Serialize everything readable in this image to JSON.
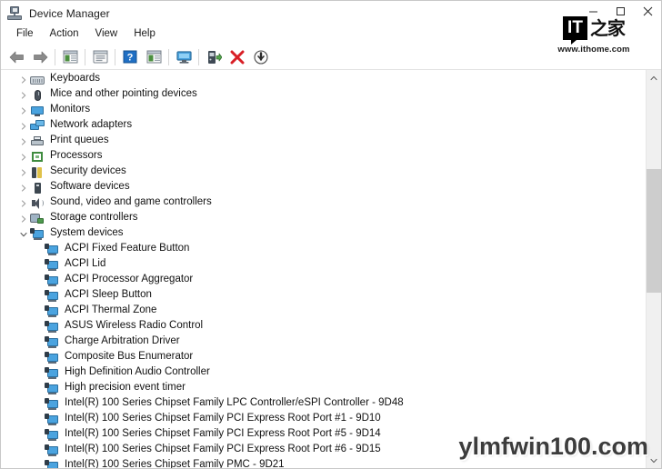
{
  "window": {
    "title": "Device Manager",
    "icon": "device-manager-icon",
    "controls": {
      "minimize": "–",
      "maximize": "□",
      "close": "✕"
    }
  },
  "menubar": {
    "items": [
      {
        "label": "File"
      },
      {
        "label": "Action"
      },
      {
        "label": "View"
      },
      {
        "label": "Help"
      }
    ]
  },
  "toolbar": {
    "buttons": [
      {
        "name": "back-arrow-icon",
        "tooltip": "Back"
      },
      {
        "name": "forward-arrow-icon",
        "tooltip": "Forward"
      },
      {
        "name": "properties-icon",
        "tooltip": "Properties"
      },
      {
        "name": "update-driver-window-icon",
        "tooltip": "Update driver"
      },
      {
        "name": "help-icon",
        "tooltip": "Help"
      },
      {
        "name": "show-hidden-devices-icon",
        "tooltip": "Show hidden devices"
      },
      {
        "name": "scan-hardware-changes-icon",
        "tooltip": "Scan for hardware changes"
      },
      {
        "name": "update-driver-green-icon",
        "tooltip": "Update driver software"
      },
      {
        "name": "uninstall-device-icon",
        "tooltip": "Uninstall device"
      },
      {
        "name": "download-driver-icon",
        "tooltip": "Download"
      }
    ]
  },
  "tree": {
    "nodes": [
      {
        "label": "Keyboards",
        "icon": "keyboard-icon",
        "level": 0,
        "expanded": false
      },
      {
        "label": "Mice and other pointing devices",
        "icon": "mouse-icon",
        "level": 0,
        "expanded": false
      },
      {
        "label": "Monitors",
        "icon": "monitor-icon",
        "level": 0,
        "expanded": false
      },
      {
        "label": "Network adapters",
        "icon": "network-icon",
        "level": 0,
        "expanded": false
      },
      {
        "label": "Print queues",
        "icon": "printer-icon",
        "level": 0,
        "expanded": false
      },
      {
        "label": "Processors",
        "icon": "processor-icon",
        "level": 0,
        "expanded": false
      },
      {
        "label": "Security devices",
        "icon": "security-icon",
        "level": 0,
        "expanded": false
      },
      {
        "label": "Software devices",
        "icon": "software-icon",
        "level": 0,
        "expanded": false
      },
      {
        "label": "Sound, video and game controllers",
        "icon": "sound-icon",
        "level": 0,
        "expanded": false
      },
      {
        "label": "Storage controllers",
        "icon": "storage-icon",
        "level": 0,
        "expanded": false
      },
      {
        "label": "System devices",
        "icon": "system-device-icon",
        "level": 0,
        "expanded": true
      },
      {
        "label": "ACPI Fixed Feature Button",
        "icon": "system-device-icon",
        "level": 1
      },
      {
        "label": "ACPI Lid",
        "icon": "system-device-icon",
        "level": 1
      },
      {
        "label": "ACPI Processor Aggregator",
        "icon": "system-device-icon",
        "level": 1
      },
      {
        "label": "ACPI Sleep Button",
        "icon": "system-device-icon",
        "level": 1
      },
      {
        "label": "ACPI Thermal Zone",
        "icon": "system-device-icon",
        "level": 1
      },
      {
        "label": "ASUS Wireless Radio Control",
        "icon": "system-device-icon",
        "level": 1
      },
      {
        "label": "Charge Arbitration Driver",
        "icon": "system-device-icon",
        "level": 1
      },
      {
        "label": "Composite Bus Enumerator",
        "icon": "system-device-icon",
        "level": 1
      },
      {
        "label": "High Definition Audio Controller",
        "icon": "system-device-icon",
        "level": 1
      },
      {
        "label": "High precision event timer",
        "icon": "system-device-icon",
        "level": 1
      },
      {
        "label": "Intel(R) 100 Series Chipset Family LPC Controller/eSPI Controller - 9D48",
        "icon": "system-device-icon",
        "level": 1
      },
      {
        "label": "Intel(R) 100 Series Chipset Family PCI Express Root Port #1 - 9D10",
        "icon": "system-device-icon",
        "level": 1
      },
      {
        "label": "Intel(R) 100 Series Chipset Family PCI Express Root Port #5 - 9D14",
        "icon": "system-device-icon",
        "level": 1
      },
      {
        "label": "Intel(R) 100 Series Chipset Family PCI Express Root Port #6 - 9D15",
        "icon": "system-device-icon",
        "level": 1
      },
      {
        "label": "Intel(R) 100 Series Chipset Family PMC - 9D21",
        "icon": "system-device-icon",
        "level": 1
      }
    ]
  },
  "scrollbar": {
    "up_arrow": "⌃",
    "down_arrow": "⌄"
  },
  "watermarks": {
    "ithome_badge": "IT",
    "ithome_cn": "之家",
    "ithome_url": "www.ithome.com",
    "ylmf": "ylmfwin100.com"
  }
}
